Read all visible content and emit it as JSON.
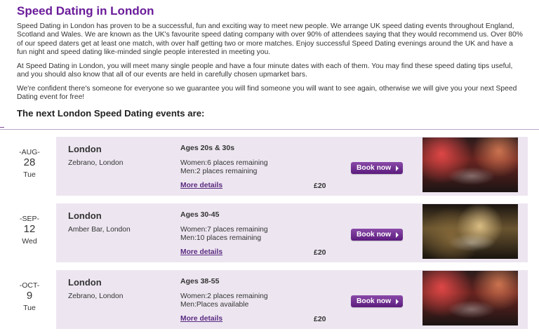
{
  "page": {
    "title": "Speed Dating in London",
    "paragraphs": [
      "Speed Dating in London has proven to be a successful, fun and exciting way to meet new people. We arrange UK speed dating events throughout England, Scotland and Wales. We are known as the UK's favourite speed dating company with over 90% of attendees saying that they would recommend us. Over 80% of our speed daters get at least one match, with over half getting two or more matches. Enjoy successful Speed Dating evenings around the UK and have a fun night and speed dating like-minded single people interested in meeting you.",
      "At Speed Dating in London, you will meet many single people and have a four minute dates with each of them. You may find these speed dating tips useful, and you should also know that all of our events are held in carefully chosen upmarket bars.",
      "We're confident there's someone for everyone so we guarantee you will find someone you will want to see again, otherwise we will give you your next Speed Dating event for free!"
    ],
    "subtitle": "The next London Speed Dating events are:"
  },
  "events": [
    {
      "month": "-AUG-",
      "day": "28",
      "weekday": "Tue",
      "city": "London",
      "venue": "Zebrano, London",
      "ages": "Ages 20s & 30s",
      "women": "Women:6 places remaining",
      "men": "Men:2 places remaining",
      "more": "More details",
      "price": "£20",
      "book": "Book now",
      "photo_icon": "bar-photo-red"
    },
    {
      "month": "-SEP-",
      "day": "12",
      "weekday": "Wed",
      "city": "London",
      "venue": "Amber Bar, London",
      "ages": "Ages 30-45",
      "women": "Women:7 places remaining",
      "men": "Men:10 places remaining",
      "more": "More details",
      "price": "£20",
      "book": "Book now",
      "photo_icon": "bar-photo-amber"
    },
    {
      "month": "-OCT-",
      "day": "9",
      "weekday": "Tue",
      "city": "London",
      "venue": "Zebrano, London",
      "ages": "Ages 38-55",
      "women": "Women:2 places remaining",
      "men": "Men:Places available",
      "more": "More details",
      "price": "£20",
      "book": "Book now",
      "photo_icon": "bar-photo-red"
    }
  ],
  "colors": {
    "title": "#6a1b9a",
    "row_bg": "#ede6f1",
    "button": "#5b1b7d"
  }
}
